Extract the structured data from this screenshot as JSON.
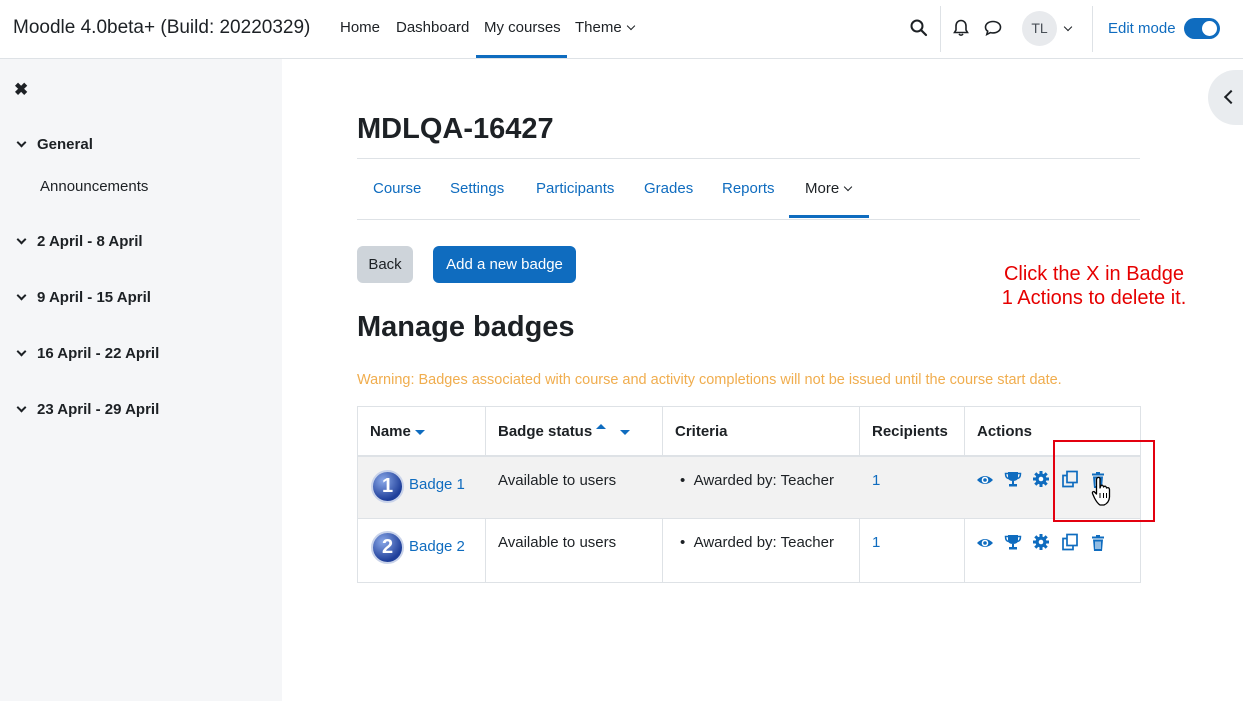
{
  "navbar": {
    "brand": "Moodle 4.0beta+ (Build: 20220329)",
    "items": [
      {
        "label": "Home"
      },
      {
        "label": "Dashboard"
      },
      {
        "label": "My courses"
      },
      {
        "label": "Theme"
      }
    ],
    "avatar_initials": "TL",
    "edit_mode_label": "Edit mode",
    "edit_mode_on": true
  },
  "sidebar": {
    "close_glyph": "✖",
    "sections": [
      {
        "label": "General",
        "children": [
          {
            "label": "Announcements"
          }
        ]
      },
      {
        "label": "2 April - 8 April"
      },
      {
        "label": "9 April - 15 April"
      },
      {
        "label": "16 April - 22 April"
      },
      {
        "label": "23 April - 29 April"
      }
    ]
  },
  "course": {
    "title": "MDLQA-16427",
    "tabs": [
      {
        "label": "Course"
      },
      {
        "label": "Settings"
      },
      {
        "label": "Participants"
      },
      {
        "label": "Grades"
      },
      {
        "label": "Reports"
      },
      {
        "label": "More"
      }
    ]
  },
  "buttons": {
    "back": "Back",
    "add_badge": "Add a new badge"
  },
  "annotation": {
    "line1": "Click the X in Badge",
    "line2": "1 Actions to delete it."
  },
  "page": {
    "heading": "Manage badges",
    "warning": "Warning: Badges associated with course and activity completions will not be issued until the course start date."
  },
  "table": {
    "headers": {
      "name": "Name",
      "status": "Badge status",
      "criteria": "Criteria",
      "recipients": "Recipients",
      "actions": "Actions"
    },
    "rows": [
      {
        "number": "1",
        "name": "Badge 1",
        "status": "Available to users",
        "criteria": "Awarded by: Teacher",
        "recipients": "1"
      },
      {
        "number": "2",
        "name": "Badge 2",
        "status": "Available to users",
        "criteria": "Awarded by: Teacher",
        "recipients": "1"
      }
    ],
    "action_icons": [
      "eye-icon",
      "trophy-icon",
      "gear-icon",
      "copy-icon",
      "trash-icon"
    ]
  },
  "colors": {
    "primary": "#0f6cbf",
    "warning": "#f0ad4e",
    "annotation": "#e60000",
    "sidebar_bg": "#f5f6f8"
  }
}
